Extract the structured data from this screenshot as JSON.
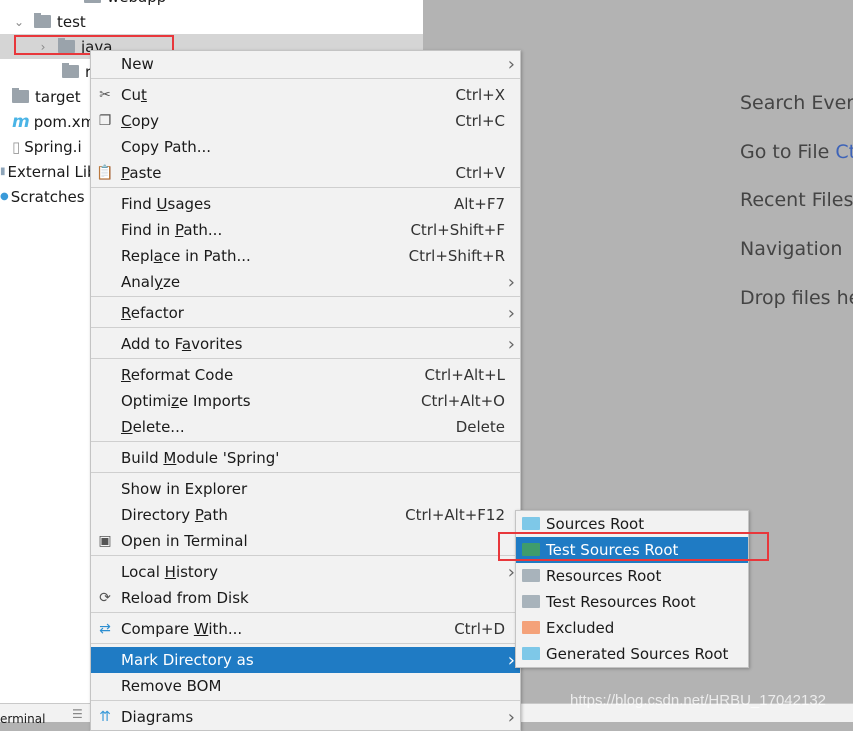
{
  "project_tree": [
    {
      "label": "webapp",
      "indent": 62,
      "chev": "›",
      "type": "folder"
    },
    {
      "label": "test",
      "indent": 12,
      "chev": "⌄",
      "type": "folder",
      "chev_before": true
    },
    {
      "label": "java",
      "indent": 36,
      "chev": "›",
      "type": "folder",
      "selected": true
    },
    {
      "label": "r",
      "indent": 62,
      "type": "folder"
    },
    {
      "label": "target",
      "indent": 12,
      "type": "folder"
    },
    {
      "label": "pom.xm",
      "indent": 12,
      "type": "maven"
    },
    {
      "label": "Spring.i",
      "indent": 12,
      "type": "iml"
    },
    {
      "label": "External Lib",
      "indent": 0,
      "type": "libs"
    },
    {
      "label": "Scratches a",
      "indent": 0,
      "type": "scratch"
    }
  ],
  "bottom_bar": {
    "terminal_label": "erminal"
  },
  "welcome": {
    "items": [
      {
        "text": "Search Every",
        "kbd": ""
      },
      {
        "text": "Go to File ",
        "kbd": "Ct"
      },
      {
        "text": "Recent Files",
        "kbd": ""
      },
      {
        "text": "Navigation ",
        "kbd": ""
      },
      {
        "text": "Drop files he",
        "kbd": ""
      }
    ]
  },
  "context_menu": {
    "items": [
      {
        "label": "New",
        "arrow": true
      },
      {
        "sep": true
      },
      {
        "label": "Cut",
        "mn": 2,
        "shortcut": "Ctrl+X",
        "icon": "scissors-icon"
      },
      {
        "label": "Copy",
        "mn": 0,
        "shortcut": "Ctrl+C",
        "icon": "copy-icon"
      },
      {
        "label": "Copy Path...",
        "shortcut": ""
      },
      {
        "label": "Paste",
        "mn": 0,
        "shortcut": "Ctrl+V",
        "icon": "clipboard-icon"
      },
      {
        "sep": true
      },
      {
        "label": "Find Usages",
        "mn": 5,
        "shortcut": "Alt+F7"
      },
      {
        "label": "Find in Path...",
        "mn": 8,
        "shortcut": "Ctrl+Shift+F"
      },
      {
        "label": "Replace in Path...",
        "mn": 4,
        "shortcut": "Ctrl+Shift+R"
      },
      {
        "label": "Analyze",
        "mn": 4,
        "arrow": true
      },
      {
        "sep": true
      },
      {
        "label": "Refactor",
        "mn": 0,
        "arrow": true
      },
      {
        "sep": true
      },
      {
        "label": "Add to Favorites",
        "mn": 8,
        "arrow": true
      },
      {
        "sep": true
      },
      {
        "label": "Reformat Code",
        "mn": 0,
        "shortcut": "Ctrl+Alt+L"
      },
      {
        "label": "Optimize Imports",
        "mn": 6,
        "shortcut": "Ctrl+Alt+O"
      },
      {
        "label": "Delete...",
        "mn": 0,
        "shortcut": "Delete"
      },
      {
        "sep": true
      },
      {
        "label": "Build Module 'Spring'",
        "mn": 6
      },
      {
        "sep": true
      },
      {
        "label": "Show in Explorer"
      },
      {
        "label": "Directory Path",
        "mn": 10,
        "shortcut": "Ctrl+Alt+F12"
      },
      {
        "label": "Open in Terminal",
        "icon": "terminal-icon"
      },
      {
        "sep": true
      },
      {
        "label": "Local History",
        "mn": 6,
        "arrow": true
      },
      {
        "label": "Reload from Disk",
        "icon": "reload-icon"
      },
      {
        "sep": true
      },
      {
        "label": "Compare With...",
        "mn": 8,
        "shortcut": "Ctrl+D",
        "icon": "compare-icon"
      },
      {
        "sep": true
      },
      {
        "label": "Mark Directory as",
        "arrow": true,
        "highlighted": true
      },
      {
        "label": "Remove BOM"
      },
      {
        "sep": true
      },
      {
        "label": "Diagrams",
        "arrow": true,
        "icon": "diagram-icon"
      }
    ]
  },
  "submenu": {
    "items": [
      {
        "label": "Sources Root",
        "color": "#7ec8e8"
      },
      {
        "label": "Test Sources Root",
        "color": "#3f9c6c",
        "highlighted": true
      },
      {
        "label": "Resources Root",
        "color": "#a8b3bb"
      },
      {
        "label": "Test Resources Root",
        "color": "#a8b3bb"
      },
      {
        "label": "Excluded",
        "color": "#f4a27a"
      },
      {
        "label": "Generated Sources Root",
        "color": "#7ec8e8"
      }
    ]
  },
  "colors": {
    "highlight": "#1f7bc4",
    "annotation_red": "#e8373b"
  },
  "watermark": "https://blog.csdn.net/HRBU_17042132"
}
